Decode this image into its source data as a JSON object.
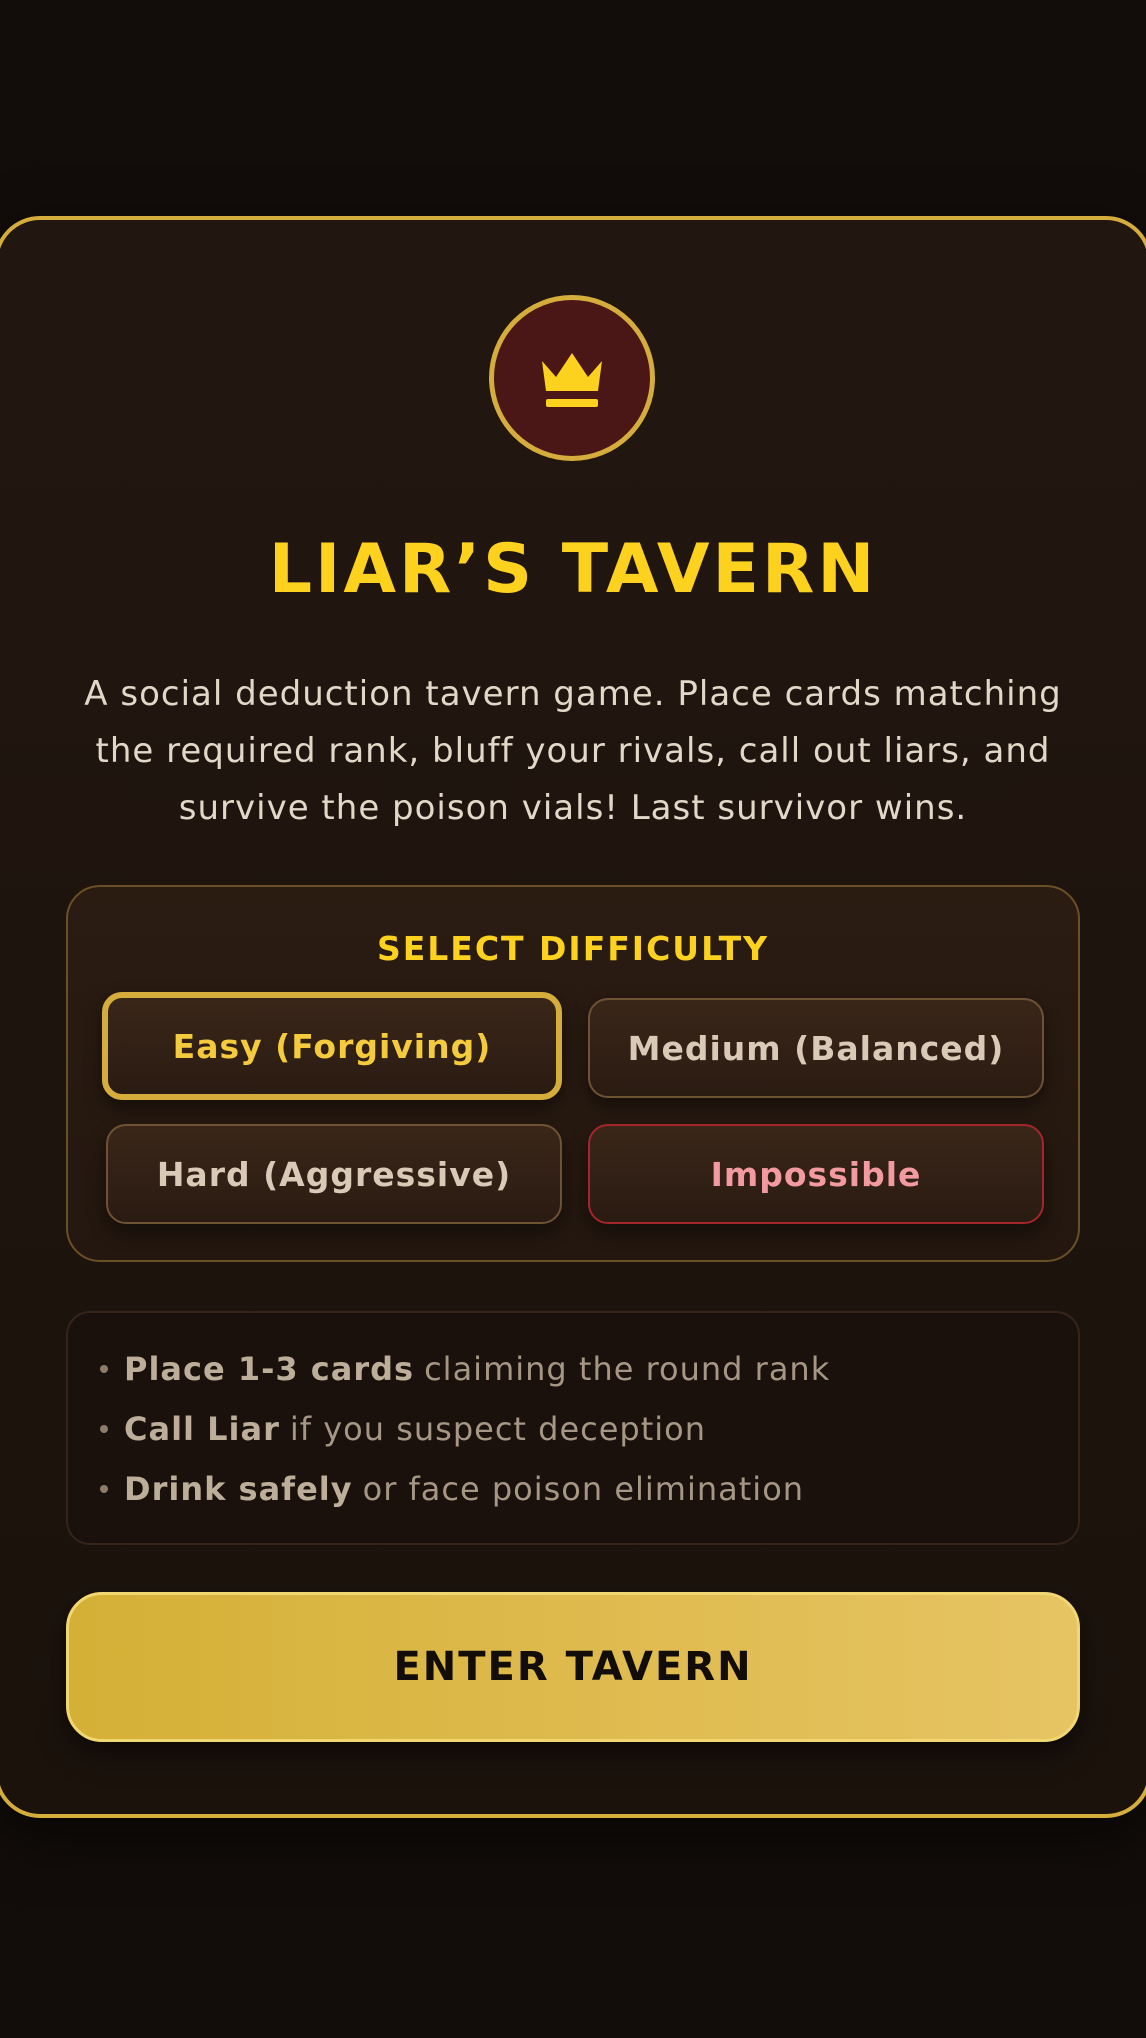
{
  "header": {
    "emblem_icon": "crown-icon",
    "title": "LIAR’S TAVERN",
    "description": "A social deduction tavern game. Place cards matching the required rank, bluff your rivals, call out liars, and survive the poison vials! Last survivor wins."
  },
  "difficulty": {
    "heading": "SELECT DIFFICULTY",
    "selected": "easy",
    "options": [
      {
        "id": "easy",
        "label": "Easy (Forgiving)"
      },
      {
        "id": "medium",
        "label": "Medium (Balanced)"
      },
      {
        "id": "hard",
        "label": "Hard (Aggressive)"
      },
      {
        "id": "impossible",
        "label": "Impossible"
      }
    ]
  },
  "rules": [
    {
      "strong": "Place 1-3 cards",
      "text": "claiming the round rank"
    },
    {
      "strong": "Call Liar",
      "text": "if you suspect deception"
    },
    {
      "strong": "Drink safely",
      "text": "or face poison elimination"
    }
  ],
  "enter_button": {
    "label": "ENTER TAVERN"
  },
  "colors": {
    "background": "#120d0a",
    "gold_border": "#d4ad3c",
    "title_yellow": "#fdd21f",
    "emblem_fill": "#4a1616",
    "danger_border": "#a3262a",
    "danger_text": "#f39aa0"
  }
}
